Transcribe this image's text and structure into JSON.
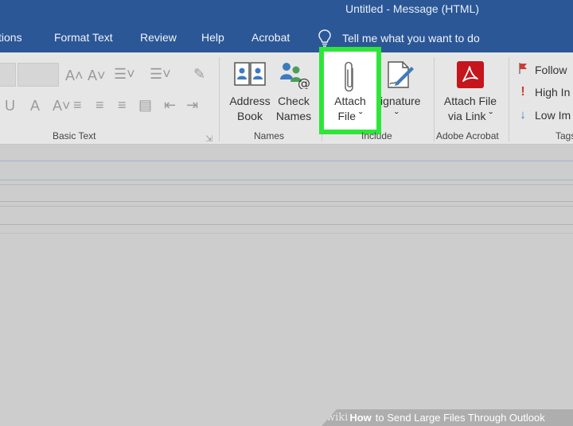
{
  "window": {
    "title": "Untitled  -  Message (HTML)"
  },
  "tabs": [
    {
      "label": "tions"
    },
    {
      "label": "Format Text"
    },
    {
      "label": "Review"
    },
    {
      "label": "Help"
    },
    {
      "label": "Acrobat"
    }
  ],
  "tell_me": {
    "label": "Tell me what you want to do",
    "icon": "lightbulb-icon"
  },
  "ribbon": {
    "basic_text": {
      "label": "Basic Text"
    },
    "names": {
      "label": "Names",
      "address_book": {
        "line1": "Address",
        "line2": "Book",
        "icon": "address-book-icon"
      },
      "check_names": {
        "line1": "Check",
        "line2": "Names",
        "icon": "check-names-icon"
      }
    },
    "include": {
      "label": "Include",
      "attach_file": {
        "line1": "Attach",
        "line2": "File ˇ",
        "icon": "paperclip-icon"
      },
      "signature": {
        "line1": "ignature",
        "line2": "ˇ",
        "icon": "signature-icon"
      }
    },
    "adobe_acrobat": {
      "label": "Adobe Acrobat",
      "attach_via_link": {
        "line1": "Attach File",
        "line2": "via Link ˇ",
        "icon": "acrobat-icon"
      }
    },
    "tags": {
      "label": "Tags",
      "follow_up": {
        "label": "Follow",
        "icon": "flag-icon"
      },
      "high_importance": {
        "label": "High In",
        "icon": "exclamation-icon"
      },
      "low_importance": {
        "label": "Low Im",
        "icon": "down-arrow-icon"
      }
    }
  },
  "colors": {
    "titlebar": "#2b5797",
    "highlight": "#2ee63a",
    "acrobat": "#c4161c"
  },
  "watermark": {
    "wiki": "wiki",
    "how": "How",
    "rest": "to Send Large Files Through Outlook"
  }
}
